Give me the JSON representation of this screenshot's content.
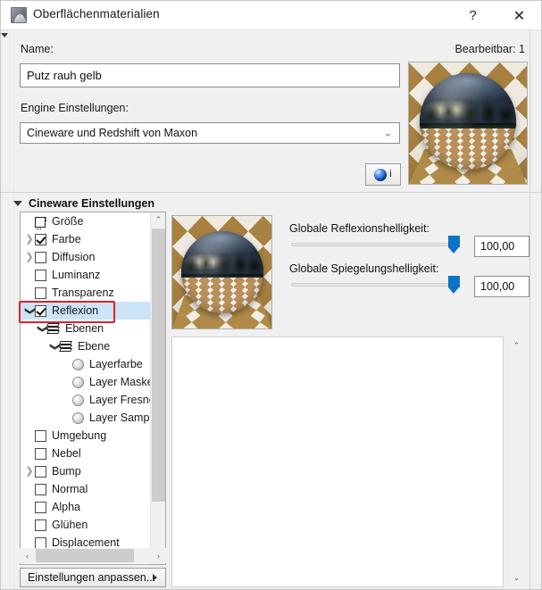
{
  "window": {
    "title": "Oberflächenmaterialien",
    "app_icon": "material-sphere-icon",
    "help_label": "?",
    "close_label": "✕"
  },
  "form": {
    "name_label": "Name:",
    "editable_label": "Bearbeitbar: 1",
    "name_value": "Putz rauh gelb",
    "name_placeholder": "Name",
    "engine_label": "Engine Einstellungen:",
    "engine_value": "Cineware und Redshift von Maxon",
    "engine_chevron": "⌄",
    "info_button_label": "i"
  },
  "section": {
    "title": "Cineware Einstellungen",
    "expanded": true
  },
  "tree": {
    "items": [
      {
        "label": "Größe",
        "indent": 1,
        "icon": "size-icon",
        "twisty": "none",
        "checkbox": "none",
        "selected": false
      },
      {
        "label": "Farbe",
        "indent": 1,
        "icon": "checkbox",
        "twisty": "collapsed",
        "checkbox": "checked",
        "selected": false
      },
      {
        "label": "Diffusion",
        "indent": 1,
        "icon": "checkbox",
        "twisty": "collapsed",
        "checkbox": "unchecked",
        "selected": false
      },
      {
        "label": "Luminanz",
        "indent": 1,
        "icon": "checkbox",
        "twisty": "none",
        "checkbox": "unchecked",
        "selected": false
      },
      {
        "label": "Transparenz",
        "indent": 1,
        "icon": "checkbox",
        "twisty": "none",
        "checkbox": "unchecked",
        "selected": false
      },
      {
        "label": "Reflexion",
        "indent": 1,
        "icon": "checkbox",
        "twisty": "expanded",
        "checkbox": "checked",
        "selected": true
      },
      {
        "label": "Ebenen",
        "indent": 2,
        "icon": "layers-icon",
        "twisty": "expanded",
        "checkbox": "none",
        "selected": false
      },
      {
        "label": "Ebene",
        "indent": 3,
        "icon": "layers-icon",
        "twisty": "expanded",
        "checkbox": "none",
        "selected": false
      },
      {
        "label": "Layerfarbe",
        "indent": 4,
        "icon": "sphere-icon",
        "twisty": "none",
        "checkbox": "none",
        "selected": false
      },
      {
        "label": "Layer Maske",
        "indent": 4,
        "icon": "sphere-icon",
        "twisty": "none",
        "checkbox": "none",
        "selected": false
      },
      {
        "label": "Layer Fresnel",
        "indent": 4,
        "icon": "sphere-icon",
        "twisty": "none",
        "checkbox": "none",
        "selected": false
      },
      {
        "label": "Layer Sampling",
        "indent": 4,
        "icon": "sphere-icon",
        "twisty": "none",
        "checkbox": "none",
        "selected": false
      },
      {
        "label": "Umgebung",
        "indent": 1,
        "icon": "checkbox",
        "twisty": "none",
        "checkbox": "unchecked",
        "selected": false
      },
      {
        "label": "Nebel",
        "indent": 1,
        "icon": "checkbox",
        "twisty": "none",
        "checkbox": "unchecked",
        "selected": false
      },
      {
        "label": "Bump",
        "indent": 1,
        "icon": "checkbox",
        "twisty": "collapsed",
        "checkbox": "unchecked",
        "selected": false
      },
      {
        "label": "Normal",
        "indent": 1,
        "icon": "checkbox",
        "twisty": "none",
        "checkbox": "unchecked",
        "selected": false
      },
      {
        "label": "Alpha",
        "indent": 1,
        "icon": "checkbox",
        "twisty": "none",
        "checkbox": "unchecked",
        "selected": false
      },
      {
        "label": "Glühen",
        "indent": 1,
        "icon": "checkbox",
        "twisty": "none",
        "checkbox": "unchecked",
        "selected": false
      },
      {
        "label": "Displacement",
        "indent": 1,
        "icon": "checkbox",
        "twisty": "none",
        "checkbox": "unchecked",
        "selected": false
      }
    ],
    "highlight_label": "Reflexion",
    "scroll_up": "⌃",
    "scroll_down": "⌄",
    "scroll_left": "‹",
    "scroll_right": "›"
  },
  "properties": {
    "slider1_label": "Globale Reflexionshelligkeit:",
    "slider1_value": "100,00",
    "slider1_percent": 100,
    "slider2_label": "Globale Spiegelungshelligkeit:",
    "slider2_value": "100,00",
    "slider2_percent": 100,
    "scroll_up": "⌃",
    "scroll_down": "⌄"
  },
  "footer": {
    "adjust_button": "Einstellungen anpassen..."
  },
  "colors": {
    "accent_blue": "#0b74c4",
    "selection_blue": "#cce4f7",
    "highlight_red": "#e32020",
    "dialog_bg": "#f0f0f0"
  }
}
